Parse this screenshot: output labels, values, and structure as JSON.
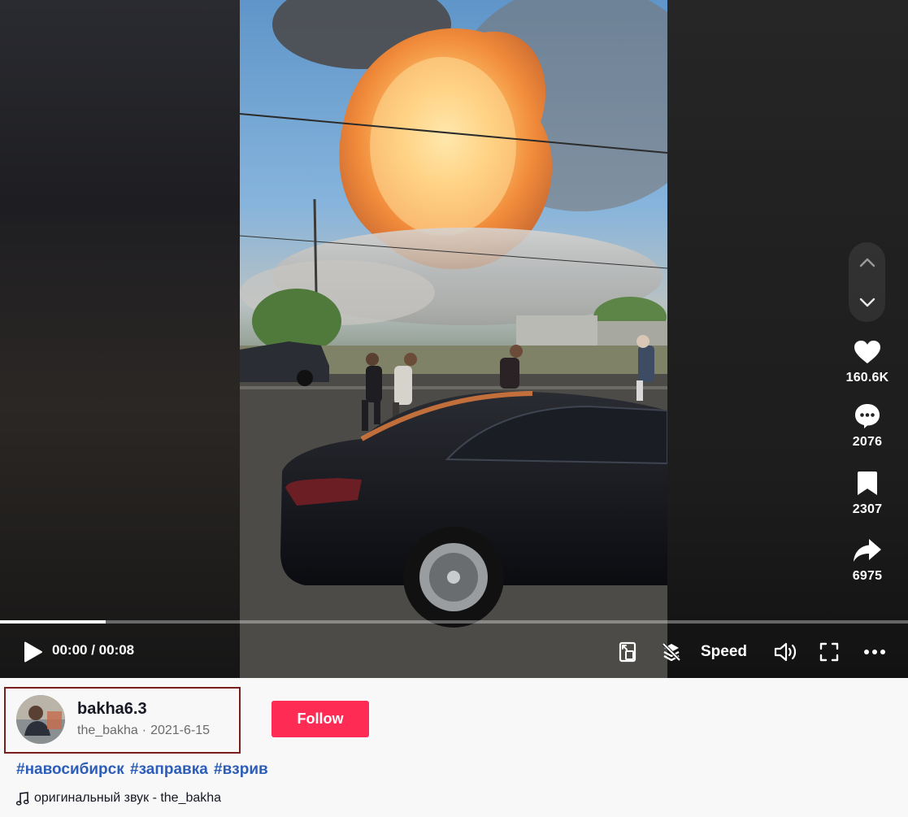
{
  "video": {
    "current_time": "00:00",
    "duration": "00:08",
    "time_separator": " / ",
    "progress": 0.116
  },
  "actions": {
    "likes": "160.6K",
    "comments": "2076",
    "saves": "2307",
    "shares": "6975"
  },
  "controls": {
    "speed_label": "Speed"
  },
  "author": {
    "username": "bakha6.3",
    "handle": "the_bakha",
    "date": "2021-6-15",
    "separator": "·"
  },
  "follow_label": "Follow",
  "hashtags": [
    "#навосибирск",
    "#заправка",
    "#взрив"
  ],
  "music": {
    "label": "оригинальный звук - the_bakha"
  },
  "colors": {
    "follow_button": "#fe2c55",
    "hashtag": "#2b5db9",
    "highlight_border": "#7a1e1e"
  },
  "icons": [
    "chevron-up-icon",
    "chevron-down-icon",
    "heart-icon",
    "comment-icon",
    "bookmark-icon",
    "share-icon",
    "play-icon",
    "pip-icon",
    "autoscroll-icon",
    "volume-icon",
    "fullscreen-icon",
    "more-icon",
    "music-note-icon"
  ]
}
